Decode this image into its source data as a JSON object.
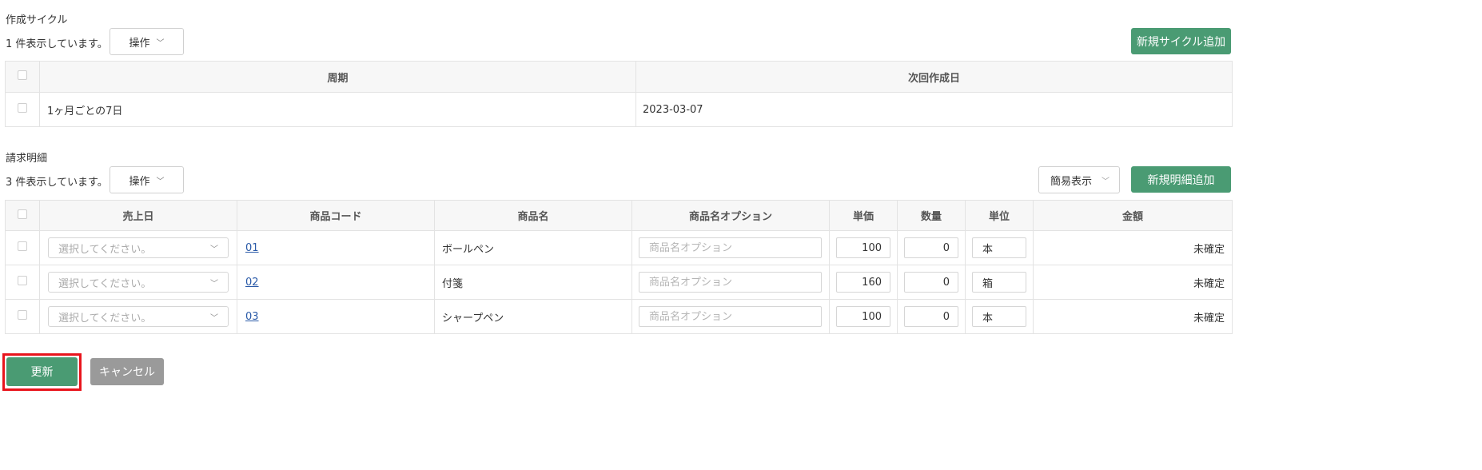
{
  "cycle": {
    "title": "作成サイクル",
    "count_text": "1 件表示しています。",
    "ops_label": "操作",
    "add_button": "新規サイクル追加",
    "headers": [
      "周期",
      "次回作成日"
    ],
    "rows": [
      {
        "period": "1ヶ月ごとの7日",
        "next_date": "2023-03-07"
      }
    ]
  },
  "billing": {
    "title": "請求明細",
    "count_text": "3 件表示しています。",
    "ops_label": "操作",
    "view_select": "簡易表示",
    "add_button": "新規明細追加",
    "headers": [
      "売上日",
      "商品コード",
      "商品名",
      "商品名オプション",
      "単価",
      "数量",
      "単位",
      "金額"
    ],
    "date_placeholder": "選択してください。",
    "option_placeholder": "商品名オプション",
    "rows": [
      {
        "code": "01",
        "name": "ボールペン",
        "price": "100",
        "qty": "0",
        "unit": "本",
        "amount": "未確定"
      },
      {
        "code": "02",
        "name": "付箋",
        "price": "160",
        "qty": "0",
        "unit": "箱",
        "amount": "未確定"
      },
      {
        "code": "03",
        "name": "シャープペン",
        "price": "100",
        "qty": "0",
        "unit": "本",
        "amount": "未確定"
      }
    ]
  },
  "footer": {
    "update_button": "更新",
    "cancel_button": "キャンセル"
  },
  "icons": {
    "dropdown": "chevron-down-icon"
  },
  "colors": {
    "primary": "#4a9b73",
    "cancel": "#9a9a9a",
    "highlight": "#e8141c",
    "link": "#2a5aa8"
  }
}
